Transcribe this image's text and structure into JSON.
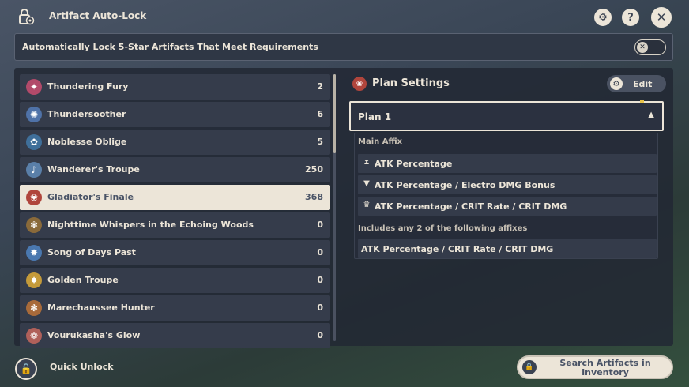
{
  "window": {
    "title": "Artifact Auto-Lock",
    "settings_glyph": "⚙",
    "help_glyph": "?",
    "close_glyph": "✕"
  },
  "auto_lock": {
    "label": "Automatically Lock 5-Star Artifacts That Meet Requirements",
    "toggle_on": false,
    "toggle_glyph": "✕"
  },
  "artifact_sets": [
    {
      "name": "Thundering Fury",
      "count": "2",
      "icon": "thundering-fury-icon",
      "glyph": "✦",
      "color": "#b24a6a",
      "selected": false
    },
    {
      "name": "Thundersoother",
      "count": "6",
      "icon": "thundersoother-icon",
      "glyph": "✺",
      "color": "#4f72a8",
      "selected": false
    },
    {
      "name": "Noblesse Oblige",
      "count": "5",
      "icon": "noblesse-oblige-icon",
      "glyph": "✿",
      "color": "#3f6f9a",
      "selected": false
    },
    {
      "name": "Wanderer's Troupe",
      "count": "250",
      "icon": "wanderers-troupe-icon",
      "glyph": "♪",
      "color": "#5a7fa8",
      "selected": false
    },
    {
      "name": "Gladiator's Finale",
      "count": "368",
      "icon": "gladiators-finale-icon",
      "glyph": "❀",
      "color": "#b0453c",
      "selected": true
    },
    {
      "name": "Nighttime Whispers in the Echoing Woods",
      "count": "0",
      "icon": "nighttime-whispers-icon",
      "glyph": "✾",
      "color": "#8a6a3a",
      "selected": false
    },
    {
      "name": "Song of Days Past",
      "count": "0",
      "icon": "song-of-days-past-icon",
      "glyph": "✹",
      "color": "#4a78b0",
      "selected": false
    },
    {
      "name": "Golden Troupe",
      "count": "0",
      "icon": "golden-troupe-icon",
      "glyph": "✸",
      "color": "#c49a3a",
      "selected": false
    },
    {
      "name": "Marechaussee Hunter",
      "count": "0",
      "icon": "marechaussee-hunter-icon",
      "glyph": "❃",
      "color": "#a86a3a",
      "selected": false
    },
    {
      "name": "Vourukasha's Glow",
      "count": "0",
      "icon": "vourukashas-glow-icon",
      "glyph": "❁",
      "color": "#b0605a",
      "selected": false
    }
  ],
  "plan_settings": {
    "title": "Plan Settings",
    "title_glyph": "❀",
    "edit_label": "Edit",
    "edit_glyph": "⚙",
    "selected_plan": "Plan 1",
    "dropdown_glyph": "▲",
    "main_affix_label": "Main Affix",
    "main_affixes": [
      {
        "icon": "sands-icon",
        "glyph": "⧗",
        "text": "ATK Percentage"
      },
      {
        "icon": "goblet-icon",
        "glyph": "▼",
        "text": "ATK Percentage / Electro DMG Bonus"
      },
      {
        "icon": "circlet-icon",
        "glyph": "♛",
        "text": "ATK Percentage / CRIT Rate / CRIT DMG"
      }
    ],
    "sub_affix_label": "Includes any 2 of the following affixes",
    "sub_affix_text": "ATK Percentage / CRIT Rate / CRIT DMG"
  },
  "bottom": {
    "quick_unlock_label": "Quick Unlock",
    "quick_unlock_glyph": "🔓",
    "search_label": "Search Artifacts in Inventory",
    "search_glyph": "🔒"
  }
}
